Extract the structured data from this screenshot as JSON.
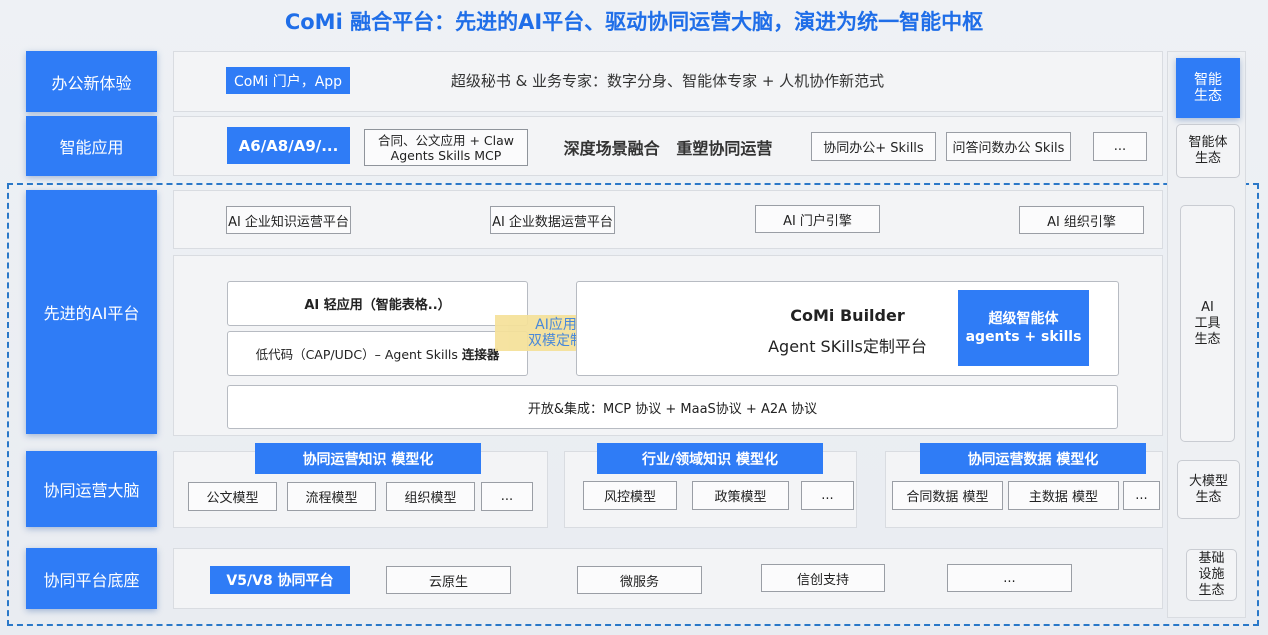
{
  "title": "CoMi 融合平台：先进的AI平台、驱动协同运营大脑，演进为统一智能中枢",
  "rows": {
    "office": "办公新体验",
    "apps": "智能应用",
    "ai_platform": "先进的AI平台",
    "brain": "协同运营大脑",
    "base": "协同平台底座"
  },
  "office_row": {
    "portal_badge": "CoMi 门户，App",
    "desc": "超级秘书 & 业务专家：数字分身、智能体专家 + 人机协作新范式"
  },
  "apps_row": {
    "badge": "A6/A8/A9/...",
    "contract_box": "合同、公文应用 + Claw\nAgents Skills MCP",
    "headline": "深度场景融合   重塑协同运营",
    "skill1": "协同办公+ Skills",
    "skill2": "问答问数办公 Skils",
    "more": "..."
  },
  "ai_row": {
    "top_boxes": [
      "AI 企业知识运营平台",
      "AI 企业数据运营平台",
      "AI 门户引擎",
      "AI 组织引擎"
    ],
    "light_app": "AI 轻应用（智能表格..）",
    "lowcode_prefix": "低代码（CAP/UDC）– Agent Skills ",
    "lowcode_bold": "连接器",
    "dual_mode": "AI应用\n双模定制",
    "builder_title": "CoMi Builder",
    "builder_sub": "Agent SKills定制平台",
    "super_agent": "超级智能体\nagents + skills",
    "open_integration": "开放&集成：MCP 协议 + MaaS协议 + A2A 协议"
  },
  "brain_row": {
    "groups": [
      {
        "header": "协同运营知识  模型化",
        "items": [
          "公文模型",
          "流程模型",
          "组织模型",
          "..."
        ]
      },
      {
        "header": "行业/领域知识  模型化",
        "items": [
          "风控模型",
          "政策模型",
          "..."
        ]
      },
      {
        "header": "协同运营数据 模型化",
        "items": [
          "合同数据 模型",
          "主数据  模型",
          "..."
        ]
      }
    ]
  },
  "base_row": {
    "badge": "V5/V8 协同平台",
    "items": [
      "云原生",
      "微服务",
      "信创支持",
      "..."
    ]
  },
  "side": {
    "smart_eco": "智能\n生态",
    "agent_eco": "智能体\n生态",
    "ai_tool_eco": "AI\n工具\n生态",
    "llm_eco": "大模型\n生态",
    "infra_eco": "基础\n设施\n生态"
  },
  "colors": {
    "brand_blue": "#2f7cf6",
    "title_blue": "#1f6ee8",
    "dash_blue": "#2a78c8",
    "highlight_yellow": "#f5e199"
  }
}
